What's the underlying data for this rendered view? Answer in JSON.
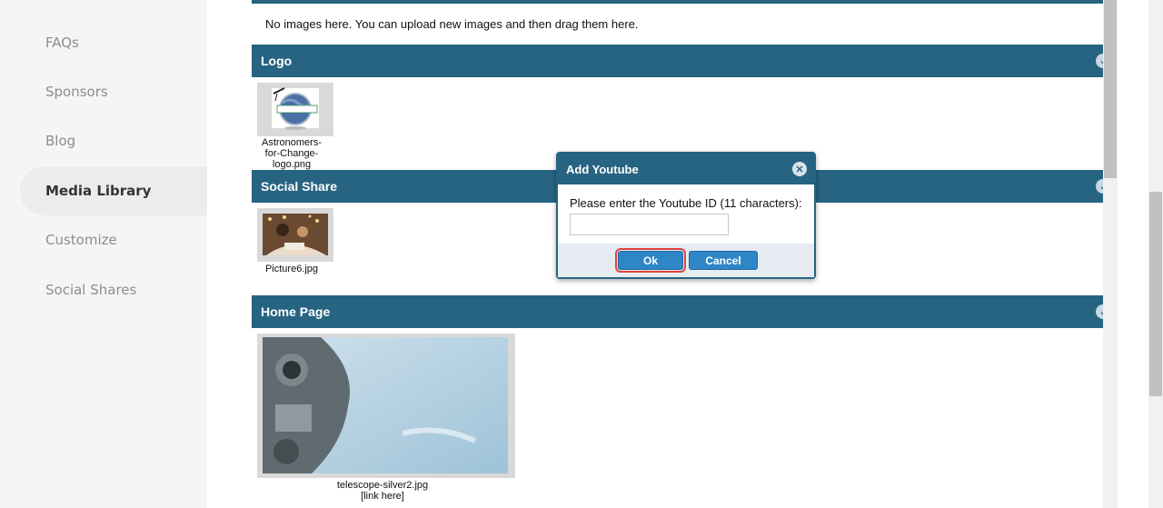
{
  "sidebar": {
    "items": [
      {
        "label": "FAQs"
      },
      {
        "label": "Sponsors"
      },
      {
        "label": "Blog"
      },
      {
        "label": "Media Library"
      },
      {
        "label": "Customize"
      },
      {
        "label": "Social Shares"
      }
    ],
    "active": "Media Library"
  },
  "main": {
    "empty_message": "No images here. You can upload new images and then drag them here.",
    "sections": [
      {
        "title": "Logo",
        "files": [
          {
            "caption_lines": [
              "Astronomers-",
              "for-Change-",
              "logo.png"
            ]
          }
        ]
      },
      {
        "title": "Social Share",
        "files": [
          {
            "caption_lines": [
              "Picture6.jpg"
            ]
          }
        ]
      },
      {
        "title": "Home Page",
        "files": [
          {
            "caption_lines": [
              "telescope-silver2.jpg",
              "[link here]"
            ]
          }
        ]
      }
    ]
  },
  "dialog": {
    "title": "Add Youtube",
    "prompt": "Please enter the Youtube ID (11 characters):",
    "input_value": "",
    "ok_label": "Ok",
    "cancel_label": "Cancel"
  },
  "colors": {
    "header_bg": "#276482",
    "button_bg": "#2f86c6",
    "highlight": "#e0443e",
    "sidebar_bg": "#f5f5f5"
  }
}
